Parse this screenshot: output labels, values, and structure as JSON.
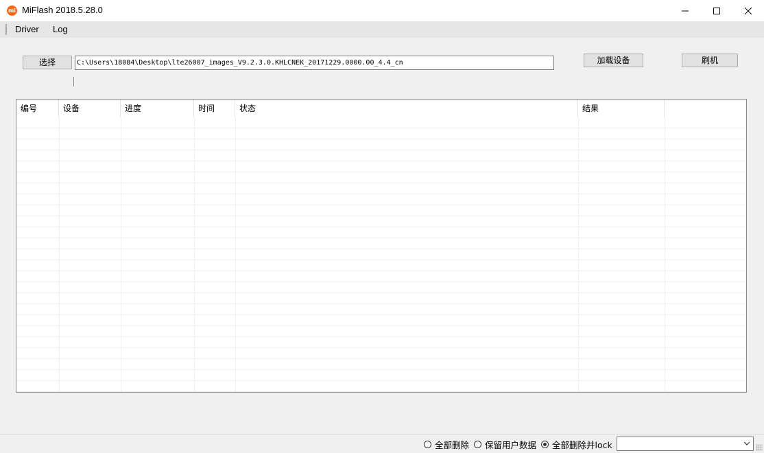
{
  "window": {
    "title": "MiFlash 2018.5.28.0",
    "app_icon_text": "mi",
    "accent": "#f26a1b"
  },
  "menu": {
    "items": [
      {
        "label": "Driver"
      },
      {
        "label": "Log"
      }
    ]
  },
  "toolbar": {
    "select_label": "选择",
    "path_value": "C:\\Users\\18084\\Desktop\\lte26007_images_V9.2.3.0.KHLCNEK_20171229.0000.00_4.4_cn",
    "load_device_label": "加载设备",
    "flash_label": "刷机"
  },
  "table": {
    "columns": [
      "编号",
      "设备",
      "进度",
      "时间",
      "状态",
      "结果",
      ""
    ],
    "rows": []
  },
  "bottom": {
    "options": [
      {
        "label": "全部删除",
        "checked": false
      },
      {
        "label": "保留用户数据",
        "checked": false
      },
      {
        "label": "全部删除并lock",
        "checked": true
      }
    ],
    "combo_value": ""
  }
}
